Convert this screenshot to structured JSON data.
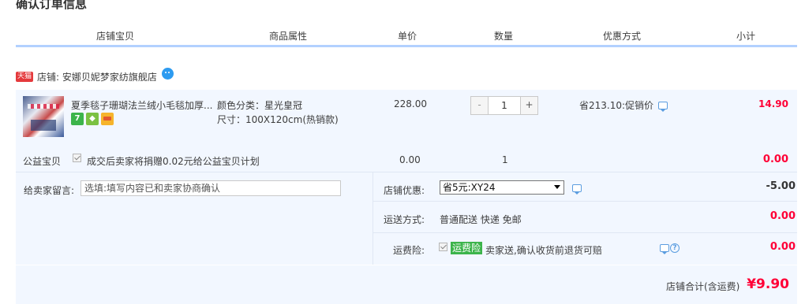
{
  "page_title": "确认订单信息",
  "columns": [
    "店铺宝贝",
    "商品属性",
    "单价",
    "数量",
    "优惠方式",
    "小计"
  ],
  "shop": {
    "badge": "天猫",
    "label": "店铺: 安娜贝妮梦家纺旗舰店"
  },
  "item": {
    "title": "夏季毯子珊瑚法兰绒小毛毯加厚...",
    "service_icons": [
      "seven-day-return-icon",
      "shield-icon",
      "credit-card-icon"
    ],
    "attrs": [
      "颜色分类：星光皇冠",
      "尺寸：100X120cm(热销款)"
    ],
    "unit_price": "228.00",
    "quantity": "1",
    "qty_minus": "-",
    "qty_plus": "+",
    "promo": "省213.10:促销价",
    "subtotal": "14.90"
  },
  "charity": {
    "label": "公益宝贝",
    "checked": true,
    "text": "成交后卖家将捐赠0.02元给公益宝贝计划",
    "price": "0.00",
    "quantity": "1",
    "subtotal": "0.00"
  },
  "message": {
    "label": "给卖家留言:",
    "placeholder": "选填:填写内容已和卖家协商确认"
  },
  "shop_discount": {
    "label": "店铺优惠:",
    "selected": "省5元:XY24",
    "value": "-5.00"
  },
  "shipping": {
    "label": "运送方式:",
    "text": "普通配送 快递 免邮",
    "value": "0.00"
  },
  "insurance": {
    "label": "运费险:",
    "checked": true,
    "badge": "运费险",
    "text": "卖家送,确认收货前退货可赔",
    "value": "0.00"
  },
  "total": {
    "label": "店铺合计(含运费)",
    "value": "¥9.90"
  },
  "colors": {
    "accent_blue": "#b2d1ff",
    "row_bg": "#f2f7ff",
    "price_red": "#ff0036",
    "badge_green": "#3cb44b"
  }
}
